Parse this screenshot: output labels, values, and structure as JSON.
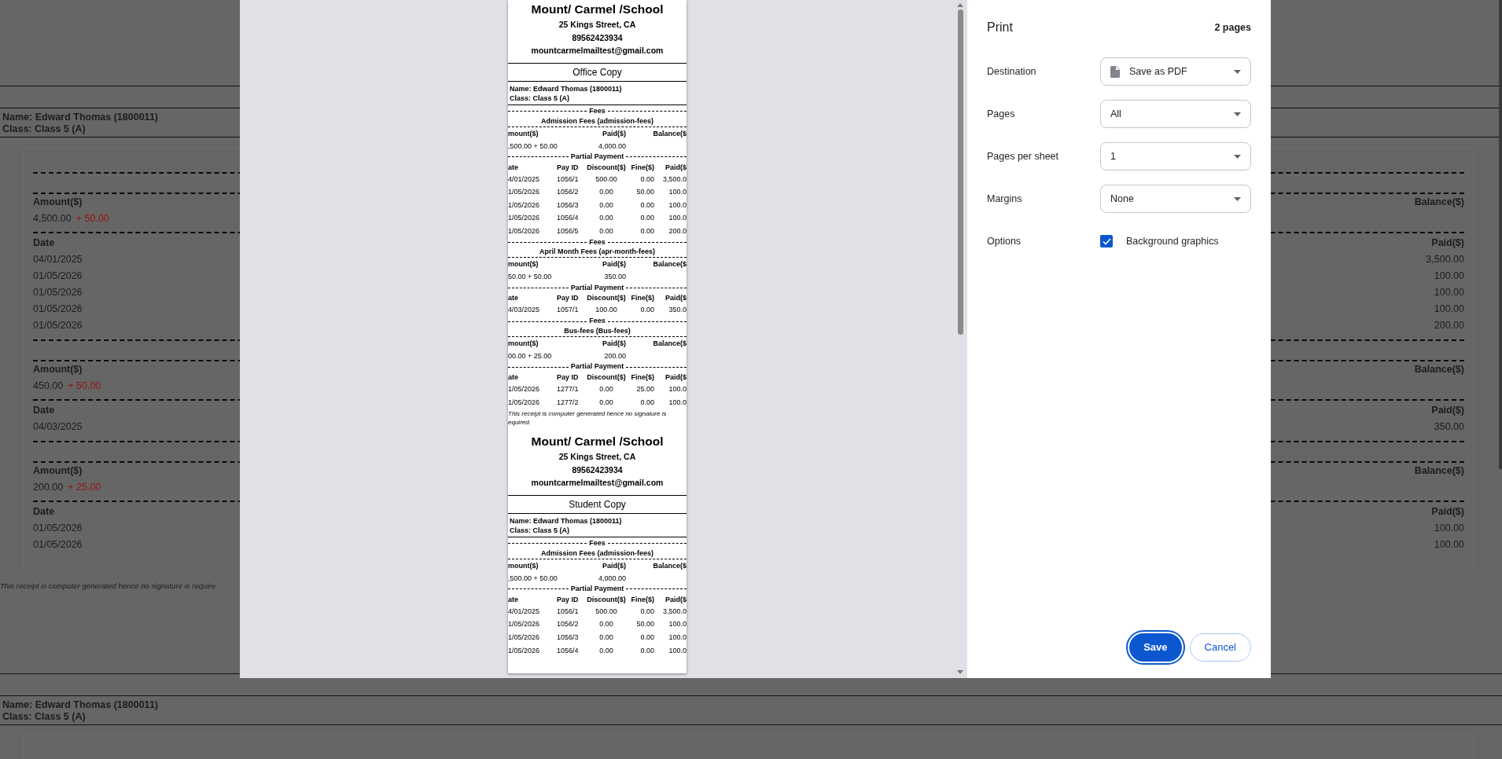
{
  "background_page": {
    "top_student": {
      "name": "Name: Edward Thomas (1800011)",
      "class": "Class: Class 5 (A)"
    },
    "fee_blocks": [
      {
        "amount_header": "Amount($)",
        "amount": "4,500.00",
        "fine": "+ 50.00",
        "balance_header": "Balance($)",
        "date_header": "Date",
        "paid_header": "Paid($)",
        "payments": [
          {
            "date": "04/01/2025",
            "paid": "3,500.00"
          },
          {
            "date": "01/05/2026",
            "paid": "100.00"
          },
          {
            "date": "01/05/2026",
            "paid": "100.00"
          },
          {
            "date": "01/05/2026",
            "paid": "100.00"
          },
          {
            "date": "01/05/2026",
            "paid": "200.00"
          }
        ]
      },
      {
        "amount_header": "Amount($)",
        "amount": "450.00",
        "fine": "+ 50.00",
        "balance_header": "Balance($)",
        "date_header": "Date",
        "paid_header": "Paid($)",
        "payments": [
          {
            "date": "04/03/2025",
            "paid": "350.00"
          }
        ]
      },
      {
        "amount_header": "Amount($)",
        "amount": "200.00",
        "fine": "+ 25.00",
        "balance_header": "Balance($)",
        "date_header": "Date",
        "paid_header": "Paid($)",
        "payments": [
          {
            "date": "01/05/2026",
            "paid": "100.00"
          },
          {
            "date": "01/05/2026",
            "paid": "100.00"
          }
        ]
      }
    ],
    "footnote": "This receipt is computer generated hence no signature is require",
    "bottom_student": {
      "name": "Name: Edward Thomas (1800011)",
      "class": "Class: Class 5 (A)"
    }
  },
  "print_dialog": {
    "preview": {
      "copies": [
        {
          "school": "Mount/ Carmel /School",
          "address": "25 Kings Street, CA",
          "phone": "89562423934",
          "email": "mountcarmelmailtest@gmail.com",
          "copy_label": "Office Copy",
          "name": "Name: Edward Thomas (1800011)",
          "class": "Class: Class 5 (A)",
          "fees": [
            {
              "section_label": "Fees",
              "fee_name": "Admission Fees (admission-fees)",
              "amount_header": "mount($)",
              "paid_header": "Paid($)",
              "balance_header": "Balance($",
              "amount": ",500.00 + 50.00",
              "paid": "4,000.00",
              "payment_label": "Partial Payment",
              "columns": [
                "ate",
                "Pay ID",
                "Discount($)",
                "Fine($)",
                "Paid($"
              ],
              "payments": [
                [
                  "4/01/2025",
                  "1056/1",
                  "500.00",
                  "0.00",
                  "3,500.0"
                ],
                [
                  "1/05/2026",
                  "1056/2",
                  "0.00",
                  "50.00",
                  "100.0"
                ],
                [
                  "1/05/2026",
                  "1056/3",
                  "0.00",
                  "0.00",
                  "100.0"
                ],
                [
                  "1/05/2026",
                  "1056/4",
                  "0.00",
                  "0.00",
                  "100.0"
                ],
                [
                  "1/05/2026",
                  "1056/5",
                  "0.00",
                  "0.00",
                  "200.0"
                ]
              ]
            },
            {
              "section_label": "Fees",
              "fee_name": "April Month Fees (apr-month-fees)",
              "amount_header": "mount($)",
              "paid_header": "Paid($)",
              "balance_header": "Balance($",
              "amount": "50.00 + 50.00",
              "paid": "350.00",
              "payment_label": "Partial Payment",
              "columns": [
                "ate",
                "Pay ID",
                "Discount($)",
                "Fine($)",
                "Paid($"
              ],
              "payments": [
                [
                  "4/03/2025",
                  "1057/1",
                  "100.00",
                  "0.00",
                  "350.0"
                ]
              ]
            },
            {
              "section_label": "Fees",
              "fee_name": "Bus-fees (Bus-fees)",
              "amount_header": "mount($)",
              "paid_header": "Paid($)",
              "balance_header": "Balance($",
              "amount": "00.00 + 25.00",
              "paid": "200.00",
              "payment_label": "Partial Payment",
              "columns": [
                "ate",
                "Pay ID",
                "Discount($)",
                "Fine($)",
                "Paid($"
              ],
              "payments": [
                [
                  "1/05/2026",
                  "1277/1",
                  "0.00",
                  "25.00",
                  "100.0"
                ],
                [
                  "1/05/2026",
                  "1277/2",
                  "0.00",
                  "0.00",
                  "100.0"
                ]
              ]
            }
          ],
          "footnote_lines": [
            "This receipt is computer generated hence no signature is",
            "equired."
          ]
        },
        {
          "school": "Mount/ Carmel /School",
          "address": "25 Kings Street, CA",
          "phone": "89562423934",
          "email": "mountcarmelmailtest@gmail.com",
          "copy_label": "Student Copy",
          "name": "Name: Edward Thomas (1800011)",
          "class": "Class: Class 5 (A)",
          "fees": [
            {
              "section_label": "Fees",
              "fee_name": "Admission Fees (admission-fees)",
              "amount_header": "mount($)",
              "paid_header": "Paid($)",
              "balance_header": "Balance($",
              "amount": ",500.00 + 50.00",
              "paid": "4,000.00",
              "payment_label": "Partial Payment",
              "columns": [
                "ate",
                "Pay ID",
                "Discount($)",
                "Fine($)",
                "Paid($"
              ],
              "payments": [
                [
                  "4/01/2025",
                  "1056/1",
                  "500.00",
                  "0.00",
                  "3,500.0"
                ],
                [
                  "1/05/2026",
                  "1056/2",
                  "0.00",
                  "50.00",
                  "100.0"
                ],
                [
                  "1/05/2026",
                  "1056/3",
                  "0.00",
                  "0.00",
                  "100.0"
                ],
                [
                  "1/05/2026",
                  "1056/4",
                  "0.00",
                  "0.00",
                  "100.0"
                ]
              ]
            }
          ]
        }
      ]
    },
    "settings": {
      "title": "Print",
      "page_count": "2 pages",
      "fields": [
        {
          "label": "Destination",
          "value": "Save as PDF",
          "kind": "destination"
        },
        {
          "label": "Pages",
          "value": "All",
          "kind": "select"
        },
        {
          "label": "Pages per sheet",
          "value": "1",
          "kind": "select"
        },
        {
          "label": "Margins",
          "value": "None",
          "kind": "select"
        }
      ],
      "options": {
        "label": "Options",
        "checkbox": {
          "label": "Background graphics",
          "checked": true
        }
      },
      "buttons": [
        {
          "label": "Save",
          "kind": "primary"
        },
        {
          "label": "Cancel",
          "kind": "secondary"
        }
      ]
    }
  }
}
